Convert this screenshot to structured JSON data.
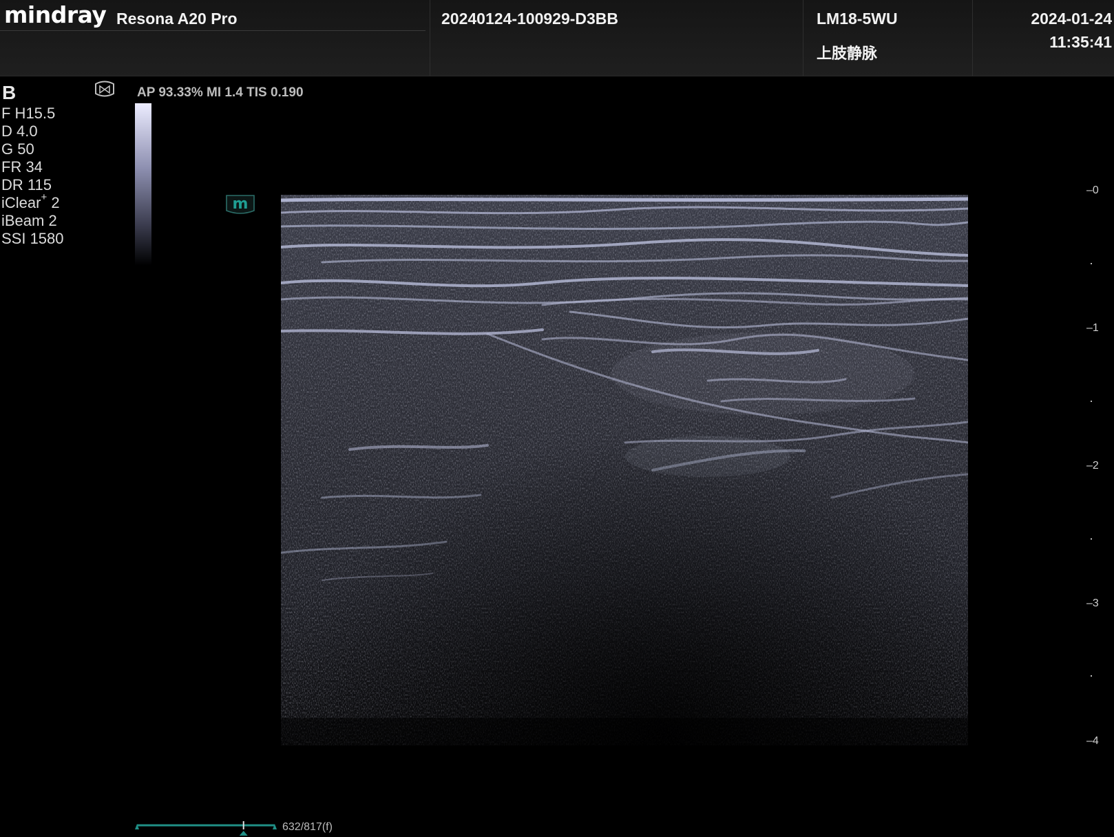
{
  "header": {
    "brand": "mindray",
    "model": "Resona A20 Pro",
    "exam_id": "20240124-100929-D3BB",
    "probe": "LM18-5WU",
    "preset": "上肢静脉",
    "date": "2024-01-24",
    "time": "11:35:41"
  },
  "params": {
    "mode": "B",
    "lines": [
      "F H15.5",
      "D 4.0",
      "G 50",
      "FR 34",
      "DR 115"
    ],
    "iclear_base": "iClear",
    "iclear_sup": "+",
    "iclear_value": " 2",
    "ibeam": "iBeam 2",
    "ssi": "SSI 1580",
    "acoustic": "AP 93.33%   MI 1.4 TIS 0.190",
    "mode_icon": "probe-orientation-icon",
    "m_badge": "m"
  },
  "depth_scale": {
    "labels": [
      "0",
      "1",
      "2",
      "3",
      "4"
    ],
    "unit_max": 4
  },
  "cine": {
    "current_frame": 632,
    "total_frames": 817,
    "frames_label": "632/817(f)"
  },
  "colors": {
    "accent_teal": "#1f8f86",
    "tissue_tint": "#a7adc9",
    "header_bg": "#1a1a1a"
  }
}
